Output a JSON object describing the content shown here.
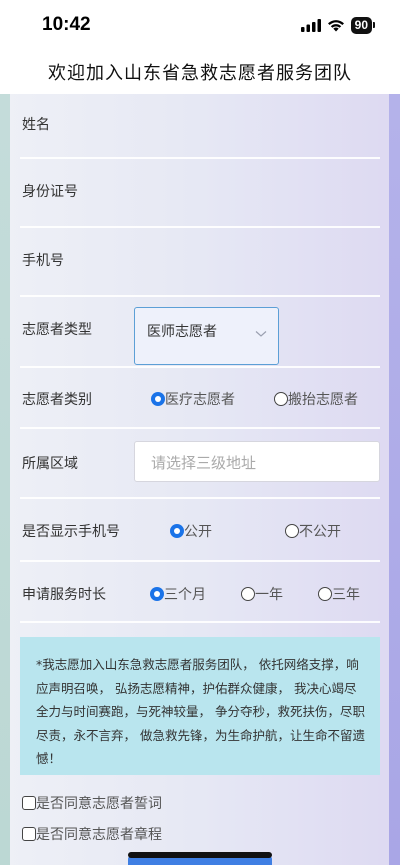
{
  "status_bar": {
    "time": "10:42",
    "battery": "90"
  },
  "header": {
    "title": "欢迎加入山东省急救志愿者服务团队"
  },
  "form": {
    "name_label": "姓名",
    "id_label": "身份证号",
    "phone_label": "手机号",
    "type_label": "志愿者类型",
    "type_value": "医师志愿者",
    "category_label": "志愿者类别",
    "category_options": [
      "医疗志愿者",
      "搬抬志愿者"
    ],
    "category_selected": "医疗志愿者",
    "area_label": "所属区域",
    "area_placeholder": "请选择三级地址",
    "show_phone_label": "是否显示手机号",
    "show_phone_options": [
      "公开",
      "不公开"
    ],
    "show_phone_selected": "公开",
    "duration_label": "申请服务时长",
    "duration_options": [
      "三个月",
      "一年",
      "三年"
    ],
    "duration_selected": "三个月"
  },
  "notice": {
    "text": "*我志愿加入山东急救志愿者服务团队， 依托网络支撑，响应声明召唤， 弘扬志愿精神，护佑群众健康， 我决心竭尽全力与时间赛跑，与死神较量， 争分夺秒，救死扶伤，尽职尽责，永不言弃， 做急救先锋，为生命护航，让生命不留遗憾！"
  },
  "agreements": {
    "oath_label": "是否同意志愿者誓词",
    "charter_label": "是否同意志愿者章程"
  },
  "colors": {
    "accent": "#1a73e8",
    "notice_bg": "#b9e5ee",
    "select_border": "#5c9fd6"
  }
}
